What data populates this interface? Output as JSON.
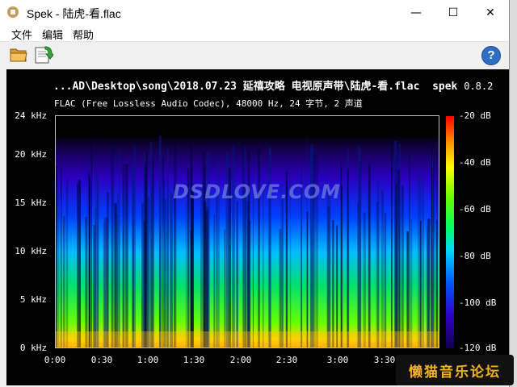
{
  "window": {
    "title": "Spek - 陆虎-看.flac",
    "minimize_glyph": "—",
    "maximize_glyph": "☐",
    "close_glyph": "✕"
  },
  "menu": {
    "file": "文件",
    "edit": "编辑",
    "help": "帮助"
  },
  "toolbar": {
    "open_icon": "folder-open-icon",
    "save_icon": "save-icon",
    "help_icon": "help-icon",
    "help_glyph": "?"
  },
  "spek": {
    "header_path": "...AD\\Desktop\\song\\2018.07.23 延禧攻略 电视原声带\\陆虎-看.flac",
    "app_name": "spek",
    "version": "0.8.2",
    "subtitle": "FLAC (Free Lossless Audio Codec), 48000 Hz, 24 字节, 2 声道",
    "watermark": "DSDLOVE.COM"
  },
  "chart_data": {
    "type": "heatmap",
    "title": "...AD\\Desktop\\song\\2018.07.23 延禧攻略 电视原声带\\陆虎-看.flac",
    "y_ticks": [
      "24 kHz",
      "20 kHz",
      "15 kHz",
      "10 kHz",
      "5 kHz",
      "0 kHz"
    ],
    "y_values_khz": [
      24,
      20,
      15,
      10,
      5,
      0
    ],
    "x_ticks": [
      "0:00",
      "0:30",
      "1:00",
      "1:30",
      "2:00",
      "2:30",
      "3:00",
      "3:30"
    ],
    "x_values_sec": [
      0,
      30,
      60,
      90,
      120,
      150,
      180,
      210
    ],
    "colorbar_ticks": [
      "-20 dB",
      "-40 dB",
      "-60 dB",
      "-80 dB",
      "-100 dB",
      "-120 dB"
    ],
    "colorbar_values_db": [
      -20,
      -40,
      -60,
      -80,
      -100,
      -120
    ]
  },
  "badge": {
    "text": "懒猫音乐论坛"
  },
  "colors": {
    "background": "#000000",
    "badge_text": "#f2b21f"
  }
}
